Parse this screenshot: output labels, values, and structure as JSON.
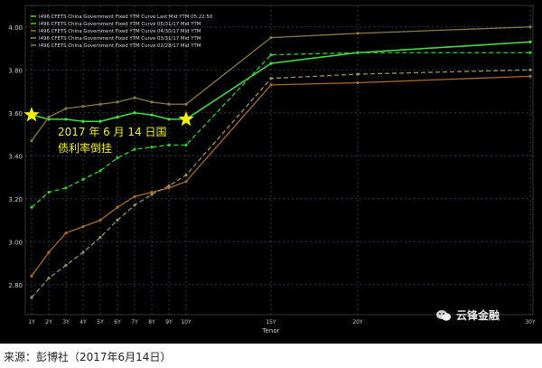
{
  "chart_data": {
    "type": "line",
    "xlabel": "Tenor",
    "x_ticks": [
      "1Y",
      "2Y",
      "3Y",
      "4Y",
      "5Y",
      "6Y",
      "7Y",
      "8Y",
      "9Y",
      "10Y",
      "15Y",
      "20Y",
      "30Y"
    ],
    "y_ticks": [
      "2.80",
      "3.00",
      "3.20",
      "3.40",
      "3.60",
      "3.80",
      "4.00"
    ],
    "ylim": [
      2.66,
      4.1
    ],
    "grid": true,
    "legend_position": "top-left",
    "series": [
      {
        "name": "I496 CFETS China Government Fixed YTM Curve Last Mid YTM 05:22:50",
        "color": "#44dd44",
        "style": "solid",
        "values": [
          3.59,
          3.57,
          3.57,
          3.56,
          3.56,
          3.58,
          3.6,
          3.59,
          3.57,
          3.57,
          3.83,
          3.88,
          3.93
        ]
      },
      {
        "name": "I496 CFETS China Government Fixed YTM Curve 05/31/17 Mid YTM",
        "color": "#33cc33",
        "style": "dashed",
        "values": [
          3.16,
          3.23,
          3.25,
          3.29,
          3.33,
          3.39,
          3.43,
          3.44,
          3.45,
          3.45,
          3.87,
          3.88,
          3.88
        ]
      },
      {
        "name": "I496 CFETS China Government Fixed YTM Curve 04/30/17 Mid YTM",
        "color": "#aa6a2a",
        "style": "solid",
        "values": [
          2.84,
          2.95,
          3.04,
          3.07,
          3.1,
          3.16,
          3.21,
          3.23,
          3.25,
          3.28,
          3.73,
          3.74,
          3.77
        ]
      },
      {
        "name": "I496 CFETS China Government Fixed YTM Curve 03/31/17 Mid YTM",
        "color": "#9a9060",
        "style": "dashed",
        "values": [
          2.74,
          2.83,
          2.89,
          2.95,
          3.02,
          3.1,
          3.17,
          3.22,
          3.26,
          3.31,
          3.76,
          3.78,
          3.8
        ]
      },
      {
        "name": "I496 CFETS China Government Fixed YTM Curve 02/28/17 Mid YTM",
        "color": "#8a7a40",
        "style": "solid",
        "values": [
          3.47,
          3.58,
          3.62,
          3.63,
          3.64,
          3.65,
          3.67,
          3.65,
          3.64,
          3.64,
          3.95,
          3.97,
          4.0
        ]
      }
    ],
    "annotation": {
      "line1": "2017 年 6 月 14 日国",
      "line2": "债利率倒挂",
      "color": "#f2f20a",
      "stars_at": [
        {
          "x": "1Y",
          "y": 3.59
        },
        {
          "x": "10Y",
          "y": 3.57
        }
      ]
    }
  },
  "watermark_text": "云锋金融",
  "caption": "来源：彭博社（2017年6月14日）",
  "colors": {
    "background": "#000000",
    "grid": "#2a3a4a",
    "axis": "#888888"
  }
}
